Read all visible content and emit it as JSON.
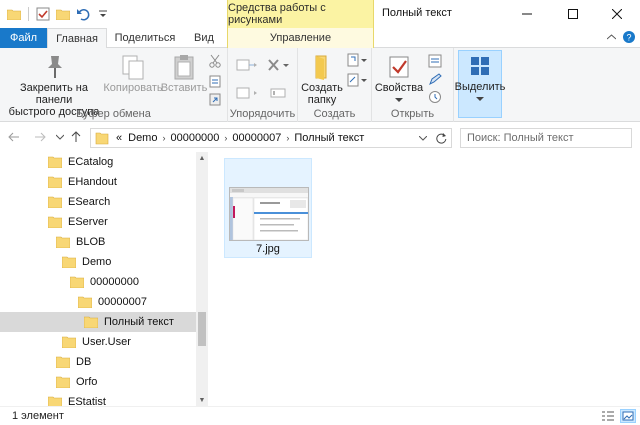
{
  "titlebar": {
    "context_tab_header": "Средства работы с рисунками",
    "title": "Полный текст"
  },
  "tabs": {
    "file": "Файл",
    "home": "Главная",
    "share": "Поделиться",
    "view": "Вид",
    "manage": "Управление"
  },
  "ribbon": {
    "clipboard": {
      "label": "Буфер обмена",
      "pin_line1": "Закрепить на панели",
      "pin_line2": "быстрого доступа",
      "copy": "Копировать",
      "paste": "Вставить"
    },
    "organize": {
      "label": "Упорядочить"
    },
    "create": {
      "label": "Создать",
      "new_folder_line1": "Создать",
      "new_folder_line2": "папку"
    },
    "open": {
      "label": "Открыть",
      "properties": "Свойства"
    },
    "select": {
      "label": "Выделить"
    }
  },
  "address": {
    "overflow": "«",
    "crumbs": [
      "Demo",
      "00000000",
      "00000007",
      "Полный текст"
    ]
  },
  "search": {
    "placeholder": "Поиск: Полный текст"
  },
  "tree": [
    {
      "label": "ECatalog"
    },
    {
      "label": "EHandout"
    },
    {
      "label": "ESearch"
    },
    {
      "label": "EServer"
    },
    {
      "label": "BLOB"
    },
    {
      "label": "Demo"
    },
    {
      "label": "00000000"
    },
    {
      "label": "00000007"
    },
    {
      "label": "Полный текст"
    },
    {
      "label": "User.User"
    },
    {
      "label": "DB"
    },
    {
      "label": "Orfo"
    },
    {
      "label": "EStatist"
    }
  ],
  "files": [
    {
      "name": "7.jpg"
    }
  ],
  "status": {
    "count_text": "1 элемент"
  },
  "colors": {
    "accent": "#1979ca",
    "folder": "#f8d775",
    "context_tab": "#fbf3a3",
    "selection": "#cce8ff"
  }
}
